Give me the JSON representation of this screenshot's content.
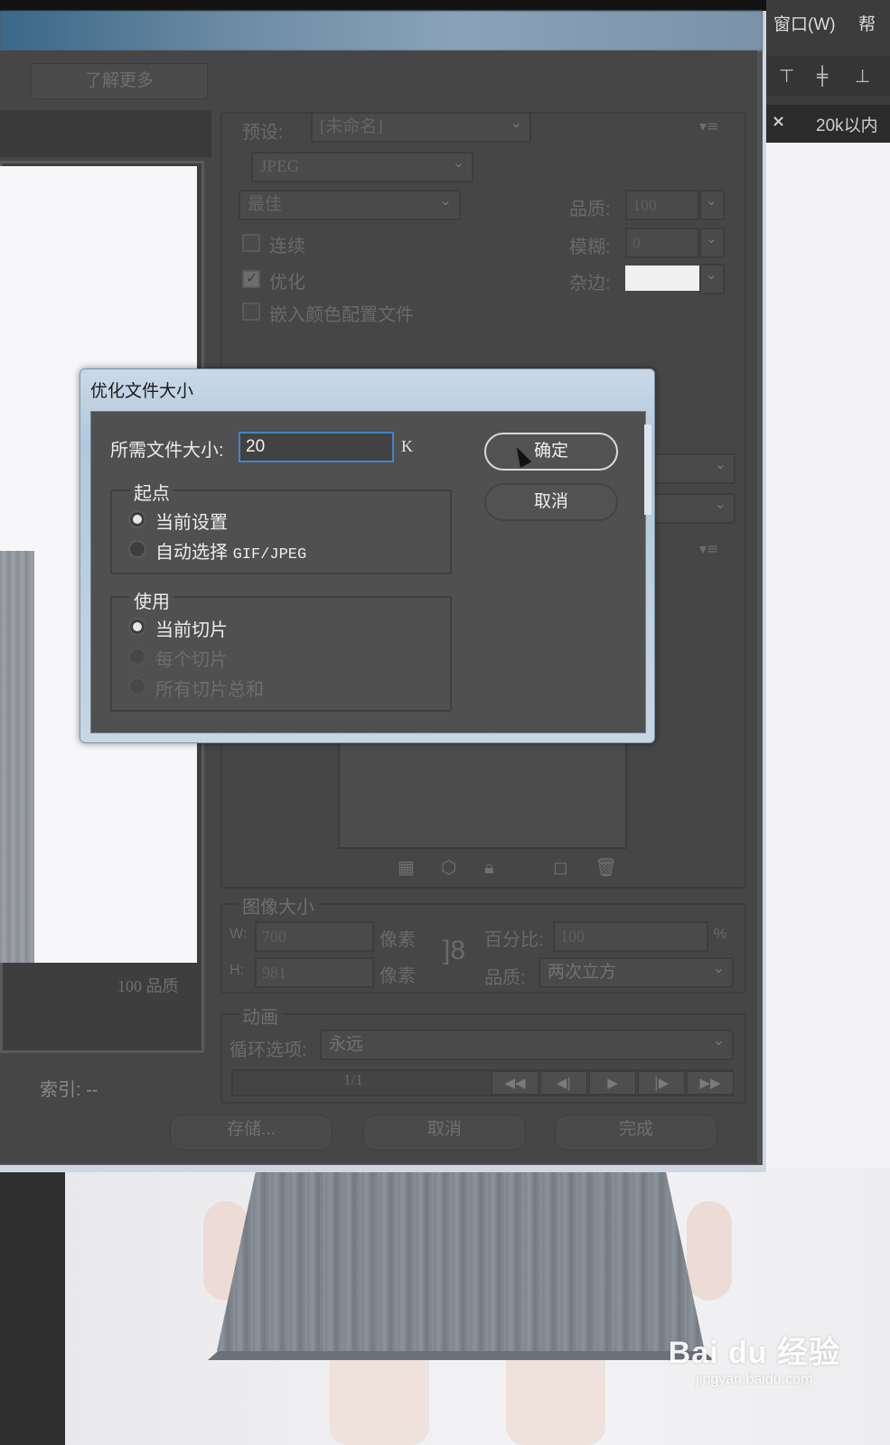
{
  "menu": {
    "window": "窗口(W)",
    "help": "帮"
  },
  "tab": {
    "close": "×",
    "title": "20k以内"
  },
  "sfw": {
    "learn_more": "了解更多",
    "preset_label": "预设:",
    "preset_value": "[未命名]",
    "format": "JPEG",
    "quality_preset": "最佳",
    "quality_label": "品质:",
    "quality_value": "100",
    "blur_label": "模糊:",
    "blur_value": "0",
    "matte_label": "杂边:",
    "progressive": "连续",
    "optimized": "优化",
    "embed_profile": "嵌入颜色配置文件",
    "preview_quality": "100 品质",
    "index": "索引: --",
    "image_size": {
      "title": "图像大小",
      "w_label": "W:",
      "w_value": "700",
      "h_label": "H:",
      "h_value": "981",
      "unit": "像素",
      "percent_label": "百分比:",
      "percent_value": "100",
      "percent_unit": "%",
      "quality_label": "品质:",
      "quality_value": "两次立方"
    },
    "animation": {
      "title": "动画",
      "loop_label": "循环选项:",
      "loop_value": "永远",
      "frame_counter": "1/1"
    },
    "buttons": {
      "save": "存储...",
      "cancel": "取消",
      "done": "完成"
    }
  },
  "optimize_dialog": {
    "title": "优化文件大小",
    "size_label": "所需文件大小:",
    "size_value": "20",
    "size_unit": "K",
    "ok": "确定",
    "cancel": "取消",
    "start_group": {
      "title": "起点",
      "options": [
        "当前设置",
        "自动选择",
        "GIF/JPEG"
      ]
    },
    "use_group": {
      "title": "使用",
      "options": [
        "当前切片",
        "每个切片",
        "所有切片总和"
      ]
    }
  },
  "watermark": {
    "logo": "Bai du 经验",
    "url": "jingyan.baidu.com"
  }
}
